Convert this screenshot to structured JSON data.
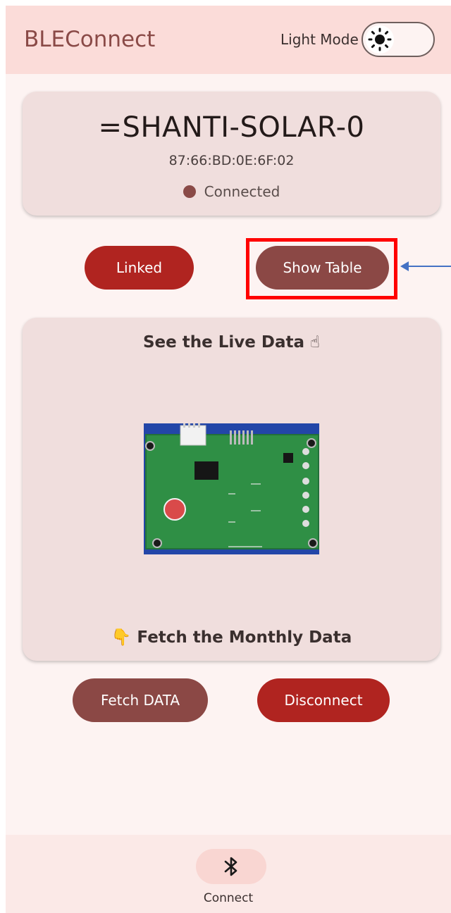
{
  "app_bar": {
    "title": "BLEConnect",
    "mode_label": "Light Mode",
    "mode_icon": "sun-icon"
  },
  "device": {
    "name": "=SHANTI-SOLAR-0",
    "mac": "87:66:BD:0E:6F:02",
    "status": "Connected"
  },
  "actions": {
    "linked_label": "Linked",
    "show_table_label": "Show Table",
    "fetch_label": "Fetch DATA",
    "disconnect_label": "Disconnect"
  },
  "live": {
    "title": "See the Live Data ☝",
    "monthly_title": "👇 Fetch the Monthly Data"
  },
  "nav": {
    "icon": "bluetooth-icon",
    "label": "Connect"
  },
  "colors": {
    "app_bar_bg": "#fbdcd9",
    "screen_bg": "#fdf3f2",
    "card_bg": "#f0dedd",
    "primary_red": "#b02420",
    "primary_brown": "#8b4845",
    "highlight": "#ff0000",
    "annotation_arrow": "#4472c4"
  }
}
